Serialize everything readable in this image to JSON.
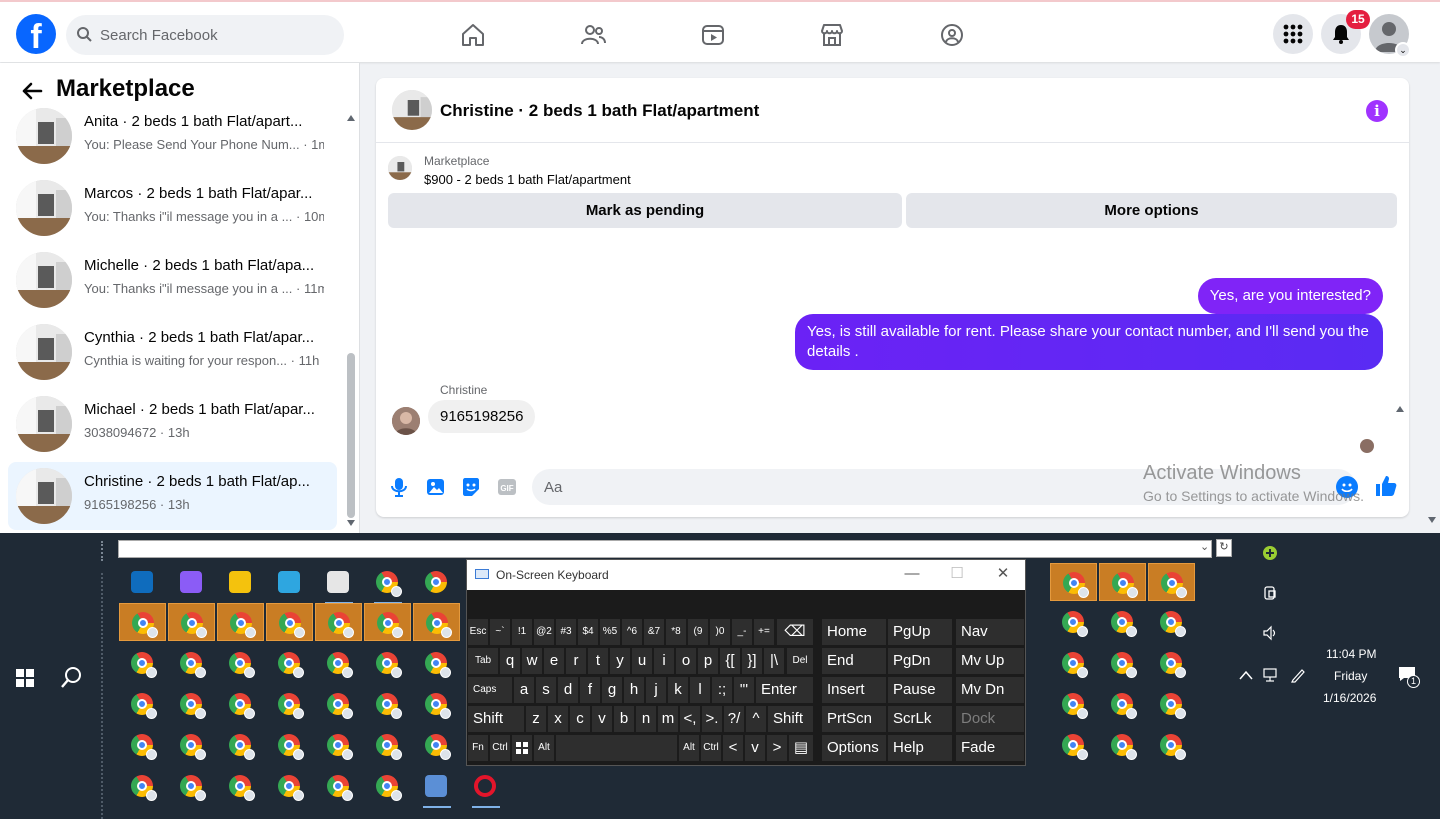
{
  "topbar": {
    "search_placeholder": "Search Facebook",
    "notification_count": "15",
    "nav_icons": [
      "home-icon",
      "friends-icon",
      "video-icon",
      "marketplace-icon",
      "groups-icon"
    ],
    "brand_color": "#0866ff"
  },
  "sidebar": {
    "title": "Marketplace",
    "conversations": [
      {
        "title": "Anita · 2 beds 1 bath Flat/apart...",
        "preview": "You: Please Send Your Phone Num... · 1m"
      },
      {
        "title": "Marcos · 2 beds 1 bath Flat/apar...",
        "preview": "You: Thanks i\"il message you in a ... · 10m"
      },
      {
        "title": "Michelle · 2 beds 1 bath Flat/apa...",
        "preview": "You: Thanks i\"il message you in a ... · 11m"
      },
      {
        "title": "Cynthia · 2 beds 1 bath Flat/apar...",
        "preview": "Cynthia is waiting for your respon... · 11h"
      },
      {
        "title": "Michael · 2 beds 1 bath Flat/apar...",
        "preview": "3038094672 · 13h"
      },
      {
        "title": "Christine · 2 beds 1 bath Flat/ap...",
        "preview": "9165198256 · 13h"
      }
    ]
  },
  "chat": {
    "title": "Christine · 2 beds 1 bath Flat/apartment",
    "info_label": "i",
    "listing_source": "Marketplace",
    "listing_name": "$900 - 2 beds 1 bath Flat/apartment",
    "mark_pending_label": "Mark as pending",
    "more_options_label": "More options",
    "messages": [
      {
        "from": "me",
        "text": "Yes, are you interested?"
      },
      {
        "from": "me",
        "text": "Yes, is still available for rent. Please share your contact number, and I'll send you the details ."
      },
      {
        "from": "Christine",
        "text": "9165198256"
      }
    ],
    "sender_name": "Christine",
    "input_placeholder": "Aa",
    "gif_label": "GIF",
    "bubble_color": "#8024f7"
  },
  "watermark": {
    "title": "Activate Windows",
    "subtitle": "Go to Settings to activate Windows."
  },
  "taskbar": {
    "time": "11:04 PM",
    "day": "Friday",
    "date": "1/16/2026",
    "notification_count": "1"
  },
  "osk": {
    "title": "On-Screen Keyboard",
    "minimize": "—",
    "maximize": "☐",
    "close": "✕",
    "keys": {
      "esc": "Esc",
      "backspace": "⌫",
      "tab": "Tab",
      "del": "Del",
      "caps": "Caps",
      "enter": "Enter",
      "shift_l": "Shift",
      "shift_r": "Shift",
      "fn": "Fn",
      "ctrl": "Ctrl",
      "alt": "Alt",
      "row1": [
        "~`",
        "!1",
        "@2",
        "#3",
        "$4",
        "%5",
        "^6",
        "&7",
        "*8",
        "(9",
        ")0",
        "_-",
        "+="
      ],
      "row2": [
        "q",
        "w",
        "e",
        "r",
        "t",
        "y",
        "u",
        "i",
        "o",
        "p",
        "{[",
        "}]",
        "|\\"
      ],
      "row3": [
        "a",
        "s",
        "d",
        "f",
        "g",
        "h",
        "j",
        "k",
        "l",
        ":;",
        "\"'"
      ],
      "row4": [
        "z",
        "x",
        "c",
        "v",
        "b",
        "n",
        "m",
        "<,",
        ">.",
        "?/",
        "^"
      ],
      "arrows": [
        "<",
        "v",
        ">"
      ],
      "nav_col1": [
        "Home",
        "End",
        "Insert",
        "PrtScn",
        "Options"
      ],
      "nav_col2": [
        "PgUp",
        "PgDn",
        "Pause",
        "ScrLk",
        "Help"
      ],
      "nav_col3": [
        "Nav",
        "Mv Up",
        "Mv Dn",
        "Dock",
        "Fade"
      ]
    }
  }
}
